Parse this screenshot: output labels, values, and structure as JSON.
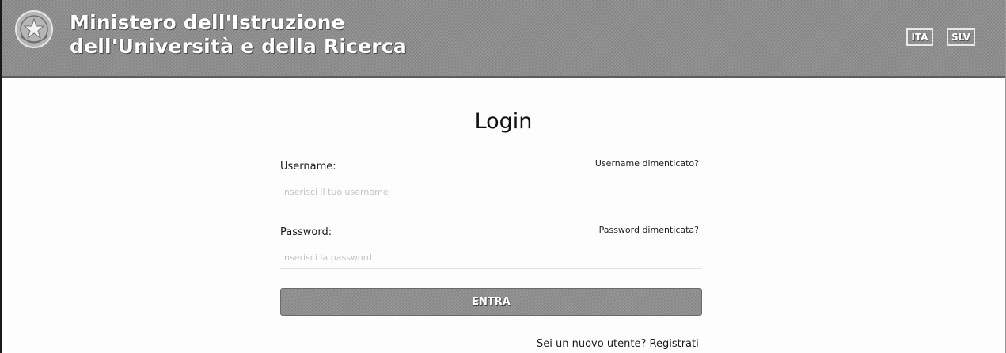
{
  "header": {
    "title_line1": "Ministero dell'Istruzione",
    "title_line2": "dell'Università e della Ricerca",
    "emblem_icon": "italian-republic-emblem-icon",
    "languages": [
      "ITA",
      "SLV"
    ]
  },
  "login": {
    "title": "Login",
    "username_label": "Username:",
    "username_forgot": "Username dimenticato?",
    "username_placeholder": "inserisci il tuo username",
    "password_label": "Password:",
    "password_forgot": "Password dimenticata?",
    "password_placeholder": "inserisci la password",
    "submit_label": "ENTRA",
    "register_question": "Sei un nuovo utente?",
    "register_link": "Registrati"
  },
  "colors": {
    "header_bg": "#8e8e8e",
    "button_bg": "#909090",
    "text": "#1a1a1a"
  }
}
